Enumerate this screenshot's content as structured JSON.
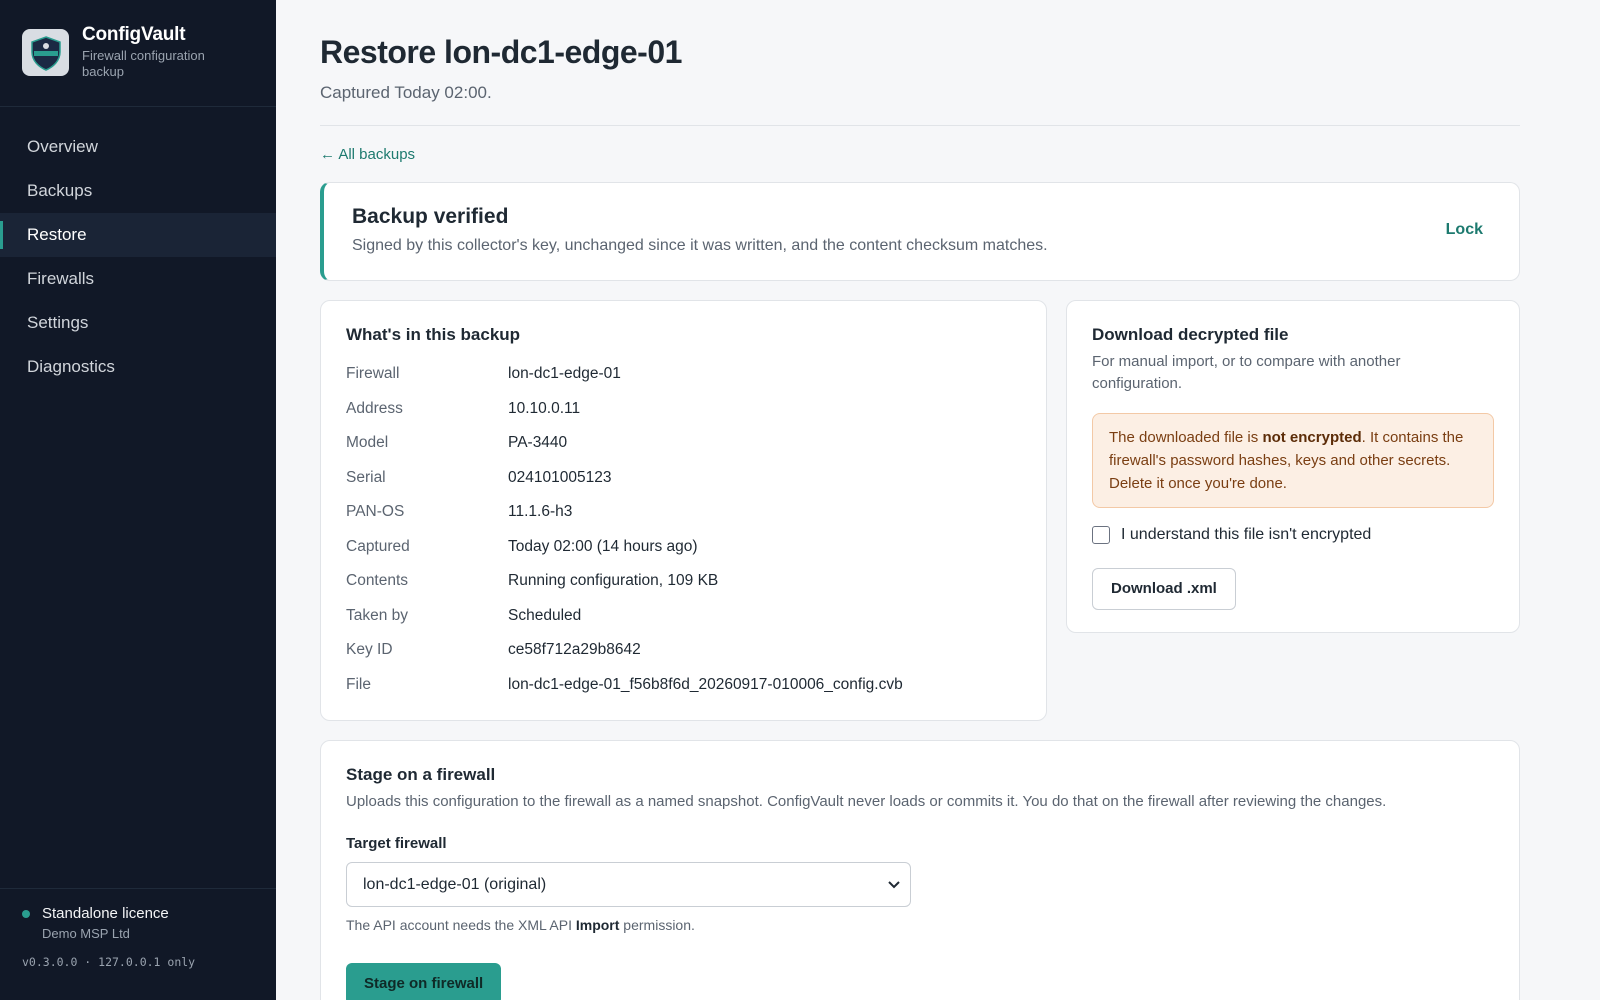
{
  "app": {
    "name": "ConfigVault",
    "subtitle": "Firewall configuration backup"
  },
  "sidebar": {
    "items": [
      {
        "label": "Overview",
        "active": false
      },
      {
        "label": "Backups",
        "active": false
      },
      {
        "label": "Restore",
        "active": true
      },
      {
        "label": "Firewalls",
        "active": false
      },
      {
        "label": "Settings",
        "active": false
      },
      {
        "label": "Diagnostics",
        "active": false
      }
    ],
    "footer": {
      "licence": "Standalone licence",
      "org": "Demo MSP Ltd",
      "version": "v0.3.0.0 · 127.0.0.1 only"
    }
  },
  "header": {
    "title": "Restore lon-dc1-edge-01",
    "subtitle": "Captured Today 02:00.",
    "back_link": "← All backups"
  },
  "verified": {
    "title": "Backup verified",
    "text": "Signed by this collector's key, unchanged since it was written, and the content checksum matches.",
    "lock_label": "Lock"
  },
  "details": {
    "title": "What's in this backup",
    "rows": [
      {
        "key": "Firewall",
        "value": "lon-dc1-edge-01"
      },
      {
        "key": "Address",
        "value": "10.10.0.11"
      },
      {
        "key": "Model",
        "value": "PA-3440"
      },
      {
        "key": "Serial",
        "value": "024101005123"
      },
      {
        "key": "PAN-OS",
        "value": "11.1.6-h3"
      },
      {
        "key": "Captured",
        "value": "Today 02:00 (14 hours ago)"
      },
      {
        "key": "Contents",
        "value": "Running configuration, 109 KB"
      },
      {
        "key": "Taken by",
        "value": "Scheduled"
      },
      {
        "key": "Key ID",
        "value": "ce58f712a29b8642"
      },
      {
        "key": "File",
        "value": "lon-dc1-edge-01_f56b8f6d_20260917-010006_config.cvb"
      }
    ]
  },
  "download": {
    "title": "Download decrypted file",
    "desc": "For manual import, or to compare with another configuration.",
    "warning_pre": "The downloaded file is ",
    "warning_bold": "not encrypted",
    "warning_post": ". It contains the firewall's password hashes, keys and other secrets. Delete it once you're done.",
    "checkbox_label": "I understand this file isn't encrypted",
    "button_label": "Download .xml"
  },
  "stage": {
    "title": "Stage on a firewall",
    "desc": "Uploads this configuration to the firewall as a named snapshot. ConfigVault never loads or commits it. You do that on the firewall after reviewing the changes.",
    "target_label": "Target firewall",
    "target_value": "lon-dc1-edge-01 (original)",
    "hint_pre": "The API account needs the XML API ",
    "hint_bold": "Import",
    "hint_post": " permission.",
    "button_label": "Stage on firewall"
  }
}
